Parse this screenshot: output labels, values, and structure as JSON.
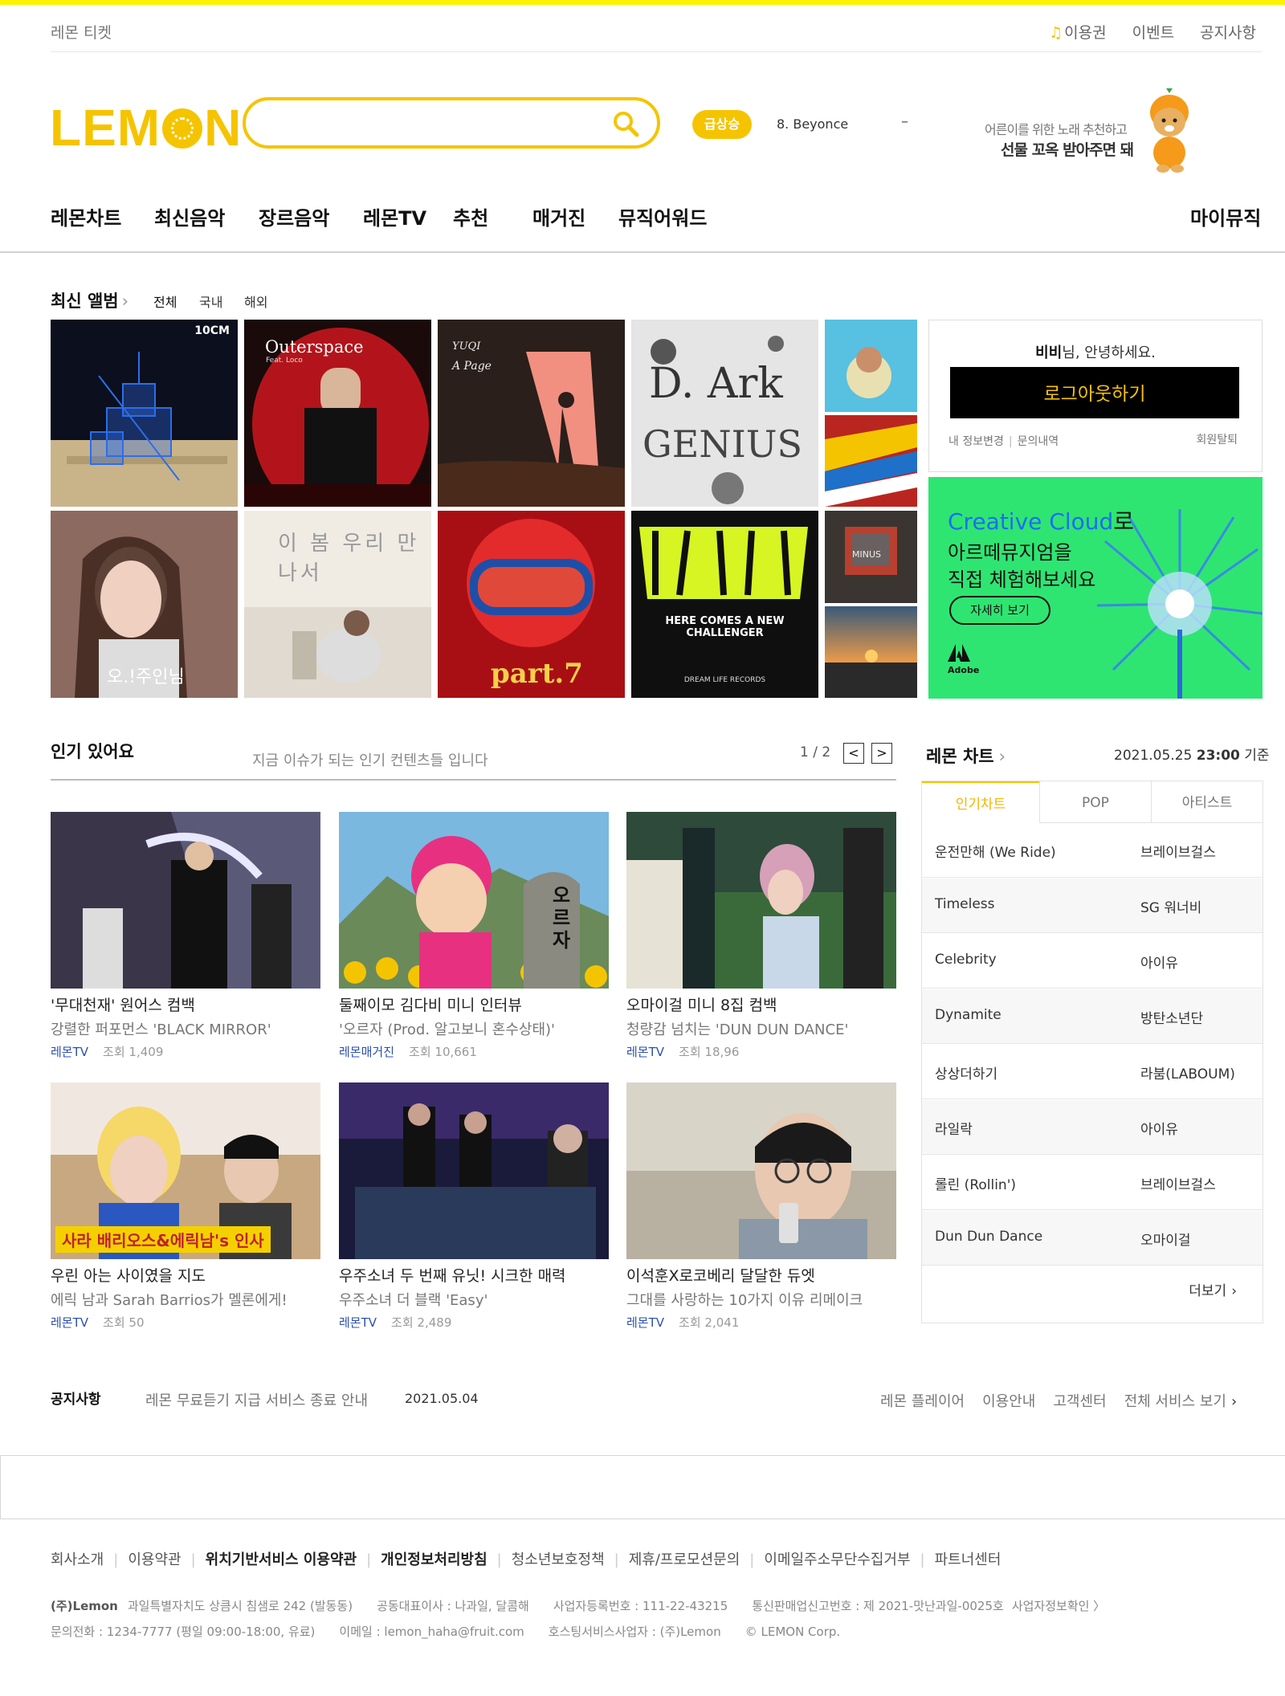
{
  "colors": {
    "brand": "#f5c400",
    "accent_top": "#fff200",
    "link_blue": "#2b4fb0"
  },
  "util": {
    "ticket": "레몬 티켓",
    "pass_icon": "music-note-icon",
    "pass": "이용권",
    "event": "이벤트",
    "notice": "공지사항"
  },
  "logo": {
    "before": "LEM",
    "after": "N"
  },
  "search": {
    "placeholder": "",
    "value": "",
    "icon": "search-icon"
  },
  "trend": {
    "badge": "급상승",
    "item": "8. Beyonce",
    "change": "–"
  },
  "promo": {
    "line1": "어른이를 위한 노래 추천하고",
    "line2": "선물 꼬옥 받아주면 돼"
  },
  "gnb": {
    "items": [
      "레몬차트",
      "최신음악",
      "장르음악",
      "레몬TV",
      "추천",
      "매거진",
      "뮤직어워드"
    ],
    "mymusic": "마이뮤직"
  },
  "albums": {
    "title": "최신 앨범",
    "filters": [
      "전체",
      "국내",
      "해외"
    ]
  },
  "album_covers": {
    "c1": "10CM",
    "c2_title": "Outerspace",
    "c2_sub": "Feat. Loco",
    "c3_title": "YUQI",
    "c3_sub": "A Page",
    "c4_title": "D. Ark",
    "c4_sub": "GENIUS",
    "c6": "오.!주인님",
    "c7": "이 봄 우리 만나서",
    "c8": "part.7",
    "c9_title": "HERE COMES A NEW CHALLENGER",
    "c9_sub": "DREAM LIFE RECORDS",
    "c10": "MINUS"
  },
  "login": {
    "user": "비비",
    "greeting": "님, 안녕하세요.",
    "logout": "로그아웃하기",
    "edit": "내 정보변경",
    "inquiry": "문의내역",
    "withdraw": "회원탈퇴"
  },
  "ad": {
    "line1a": "Creative Cloud",
    "line1b": "로",
    "line2": "아르떼뮤지엄을",
    "line3": "직접 체험해보세요",
    "button": "자세히 보기",
    "brand": "Adobe"
  },
  "popular": {
    "title": "인기 있어요",
    "subtitle": "지금 이슈가 되는 인기 컨텐츠들 입니다",
    "page": "1 / 2",
    "prev": "<",
    "next": ">",
    "views_label": "조회",
    "cards": [
      {
        "t1": "'무대천재' 원어스 컴백",
        "t2": "강렬한 퍼포먼스 'BLACK MIRROR'",
        "src": "레몬TV",
        "views": "1,409"
      },
      {
        "t1": "둘째이모 김다비 미니 인터뷰",
        "t2": "'오르자 (Prod. 알고보니 혼수상태)'",
        "src": "레몬매거진",
        "views": "10,661"
      },
      {
        "t1": "오마이걸 미니 8집 컴백",
        "t2": "청량감 넘치는 'DUN DUN DANCE'",
        "src": "레몬TV",
        "views": "18,96"
      },
      {
        "t1": "우린 아는 사이였을 지도",
        "t2": "에릭 남과 Sarah Barrios가 멜론에게!",
        "src": "레몬TV",
        "views": "50"
      },
      {
        "t1": "우주소녀 두 번째 유닛! 시크한 매력",
        "t2": "우주소녀 더 블랙 'Easy'",
        "src": "레몬TV",
        "views": "2,489"
      },
      {
        "t1": "이석훈X로코베리 달달한 듀엣",
        "t2": "그대를 사랑하는 10가지 이유 리메이크",
        "src": "레몬TV",
        "views": "2,041"
      }
    ],
    "thumb_texts": {
      "t2_stone": "오르자",
      "t4_banner": "사라 배리오스&에릭남's 인사"
    }
  },
  "chart": {
    "title": "레몬 차트",
    "date": "2021.05.25",
    "time": "23:00",
    "suffix": "기준",
    "tabs": [
      "인기차트",
      "POP",
      "아티스트"
    ],
    "rows": [
      {
        "song": "운전만해 (We Ride)",
        "artist": "브레이브걸스"
      },
      {
        "song": "Timeless",
        "artist": "SG 워너비"
      },
      {
        "song": "Celebrity",
        "artist": "아이유"
      },
      {
        "song": "Dynamite",
        "artist": "방탄소년단"
      },
      {
        "song": "상상더하기",
        "artist": "라붐(LABOUM)"
      },
      {
        "song": "라일락",
        "artist": "아이유"
      },
      {
        "song": "롤린 (Rollin')",
        "artist": "브레이브걸스"
      },
      {
        "song": "Dun Dun Dance",
        "artist": "오마이걸"
      }
    ],
    "more": "더보기"
  },
  "notice": {
    "label": "공지사항",
    "text": "레몬 무료듣기 지급 서비스 종료 안내",
    "date": "2021.05.04",
    "links": [
      "레몬 플레이어",
      "이용안내",
      "고객센터",
      "전체 서비스 보기"
    ]
  },
  "footer": {
    "links": [
      "회사소개",
      "이용약관",
      "위치기반서비스 이용약관",
      "개인정보처리방침",
      "청소년보호정책",
      "제휴/프로모션문의",
      "이메일주소무단수집거부",
      "파트너센터"
    ],
    "company": "(주)Lemon",
    "address": "과일특별자치도 상큼시 침샘로 242 (발동동)",
    "ceo": "공동대표이사 : 나과일, 달콤해",
    "bizno": "사업자등록번호 : 111-22-43215",
    "mailorder": "통신판매업신고번호 : 제 2021-맛난과일-0025호",
    "bizinfo": "사업자정보확인 〉",
    "phone": "문의전화 : 1234-7777 (평일 09:00-18:00, 유료)",
    "email": "이메일 : lemon_haha@fruit.com",
    "hosting": "호스팅서비스사업자 : (주)Lemon",
    "copyright": "© LEMON Corp."
  }
}
